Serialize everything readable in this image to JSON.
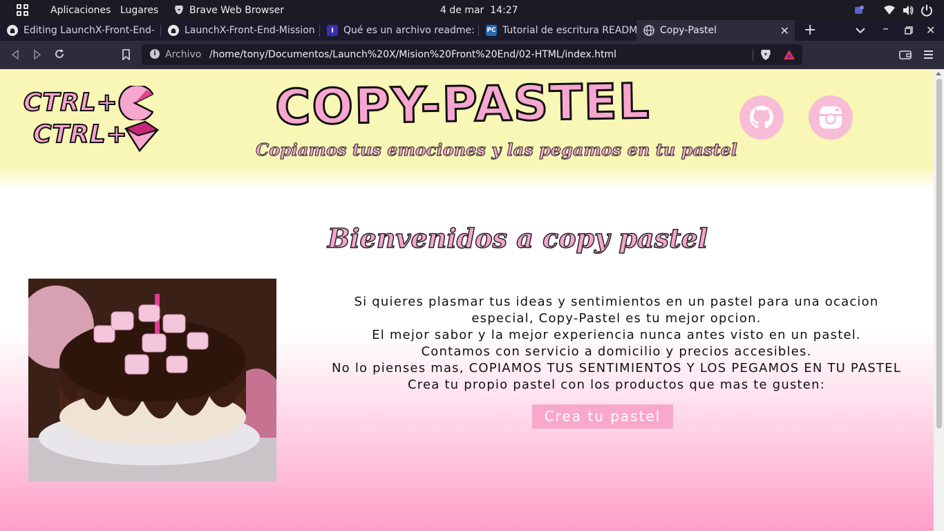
{
  "topbar": {
    "apps_label": "Aplicaciones",
    "places_label": "Lugares",
    "active_app": "Brave Web Browser",
    "date": "4 de mar",
    "time": "14:27"
  },
  "tabs": [
    {
      "title": "Editing LaunchX-Front-End-",
      "favicon": "github-icon"
    },
    {
      "title": "LaunchX-Front-End-Mission",
      "favicon": "github-icon"
    },
    {
      "title": "Qué es un archivo readme: ex",
      "favicon": "i-logo-icon"
    },
    {
      "title": "Tutorial de escritura READMI",
      "favicon": "pc-logo-icon"
    },
    {
      "title": "Copy-Pastel",
      "favicon": "globe-icon",
      "active": true
    }
  ],
  "addressbar": {
    "scheme_label": "Archivo",
    "url": "/home/tony/Documentos/Launch%20X/Mision%20Front%20End/02-HTML/index.html"
  },
  "page": {
    "logo": {
      "line1": "CTRL+",
      "line2": "CTRL+"
    },
    "brand_title": "COPY-PASTEL",
    "brand_subtitle": "Copiamos tus emociones y las pegamos en tu pastel",
    "welcome": "Bienvenidos a copy pastel",
    "intro_lines": [
      "Si quieres plasmar tus ideas y sentimientos en un pastel para una ocacion",
      "especial, Copy-Pastel es tu mejor opcion.",
      "El mejor sabor y la mejor experiencia nunca antes visto en un pastel.",
      "Contamos con servicio a domicilio y precios accesibles.",
      "No lo pienses mas, COPIAMOS TUS SENTIMIENTOS Y LOS PEGAMOS EN TU PASTEL",
      "Crea tu propio pastel con los productos que mas te gusten:"
    ],
    "cta_label": "Crea tu pastel"
  },
  "colors": {
    "header_yellow": "#f9f7b5",
    "brand_pink": "#f6a6cf",
    "cta_pink": "#f8a8cb",
    "bottom_pink": "#ff9fc7"
  }
}
